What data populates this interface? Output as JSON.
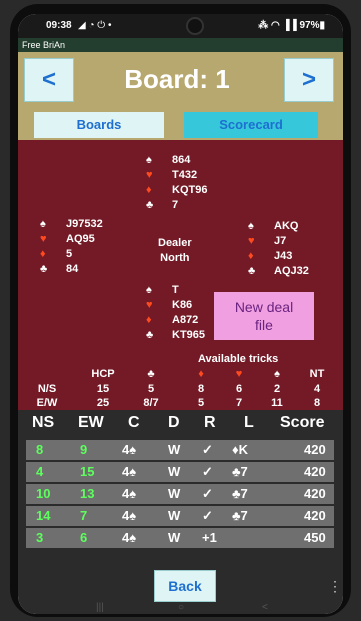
{
  "status": {
    "time": "09:38",
    "icons_left": "◢ ◔ ⏻ •",
    "icons_right": "⁂ ◠ ▐▐ 97%▮"
  },
  "app": {
    "name": "Free BriAn"
  },
  "header": {
    "prev": "<",
    "next": ">",
    "title": "Board: 1"
  },
  "tabs": {
    "boards": "Boards",
    "scorecard": "Scorecard"
  },
  "hands": {
    "north": {
      "spades": "864",
      "hearts": "T432",
      "diamonds": "KQT96",
      "clubs": "7"
    },
    "west": {
      "spades": "J97532",
      "hearts": "AQ95",
      "diamonds": "5",
      "clubs": "84"
    },
    "east": {
      "spades": "AKQ",
      "hearts": "J7",
      "diamonds": "J43",
      "clubs": "AQJ32"
    },
    "south": {
      "spades": "T",
      "hearts": "K86",
      "diamonds": "A872",
      "clubs": "KT965"
    }
  },
  "suits": {
    "spade": "♠",
    "heart": "♥",
    "diamond": "♦",
    "club": "♣"
  },
  "dealer": {
    "label": "Dealer",
    "value": "North"
  },
  "new_deal": {
    "line1": "New deal",
    "line2": "file"
  },
  "available_tricks": {
    "title": "Available tricks",
    "hcp_header": "HCP",
    "nt_header": "NT",
    "rows": [
      {
        "label": "N/S",
        "hcp": "15",
        "clubs": "5",
        "diamonds": "8",
        "hearts": "6",
        "spades": "2",
        "nt": "4"
      },
      {
        "label": "E/W",
        "hcp": "25",
        "clubs": "8/7",
        "diamonds": "5",
        "hearts": "7",
        "spades": "11",
        "nt": "8"
      }
    ]
  },
  "results": {
    "headers": {
      "ns": "NS",
      "ew": "EW",
      "contract": "C",
      "declarer": "D",
      "result": "R",
      "lead": "L",
      "score": "Score"
    },
    "rows": [
      {
        "ns": "8",
        "ew": "9",
        "contract": "4♠",
        "declarer": "W",
        "result": "✓",
        "lead": "♦K",
        "score": "420"
      },
      {
        "ns": "4",
        "ew": "15",
        "contract": "4♠",
        "declarer": "W",
        "result": "✓",
        "lead": "♣7",
        "score": "420"
      },
      {
        "ns": "10",
        "ew": "13",
        "contract": "4♠",
        "declarer": "W",
        "result": "✓",
        "lead": "♣7",
        "score": "420"
      },
      {
        "ns": "14",
        "ew": "7",
        "contract": "4♠",
        "declarer": "W",
        "result": "✓",
        "lead": "♣7",
        "score": "420"
      },
      {
        "ns": "3",
        "ew": "6",
        "contract": "4♠",
        "declarer": "W",
        "result": "+1",
        "lead": "",
        "score": "450"
      }
    ]
  },
  "footer": {
    "back": "Back",
    "more": "⋮"
  },
  "sysnav": {
    "recent": "|||",
    "home": "○",
    "back": "<"
  },
  "colors": {
    "board_bg": "#731a26",
    "header_bg": "#b7a870",
    "tab_active": "#36c8da",
    "ns_ew_green": "#5dff5d",
    "heart_red": "#ff4a20"
  }
}
